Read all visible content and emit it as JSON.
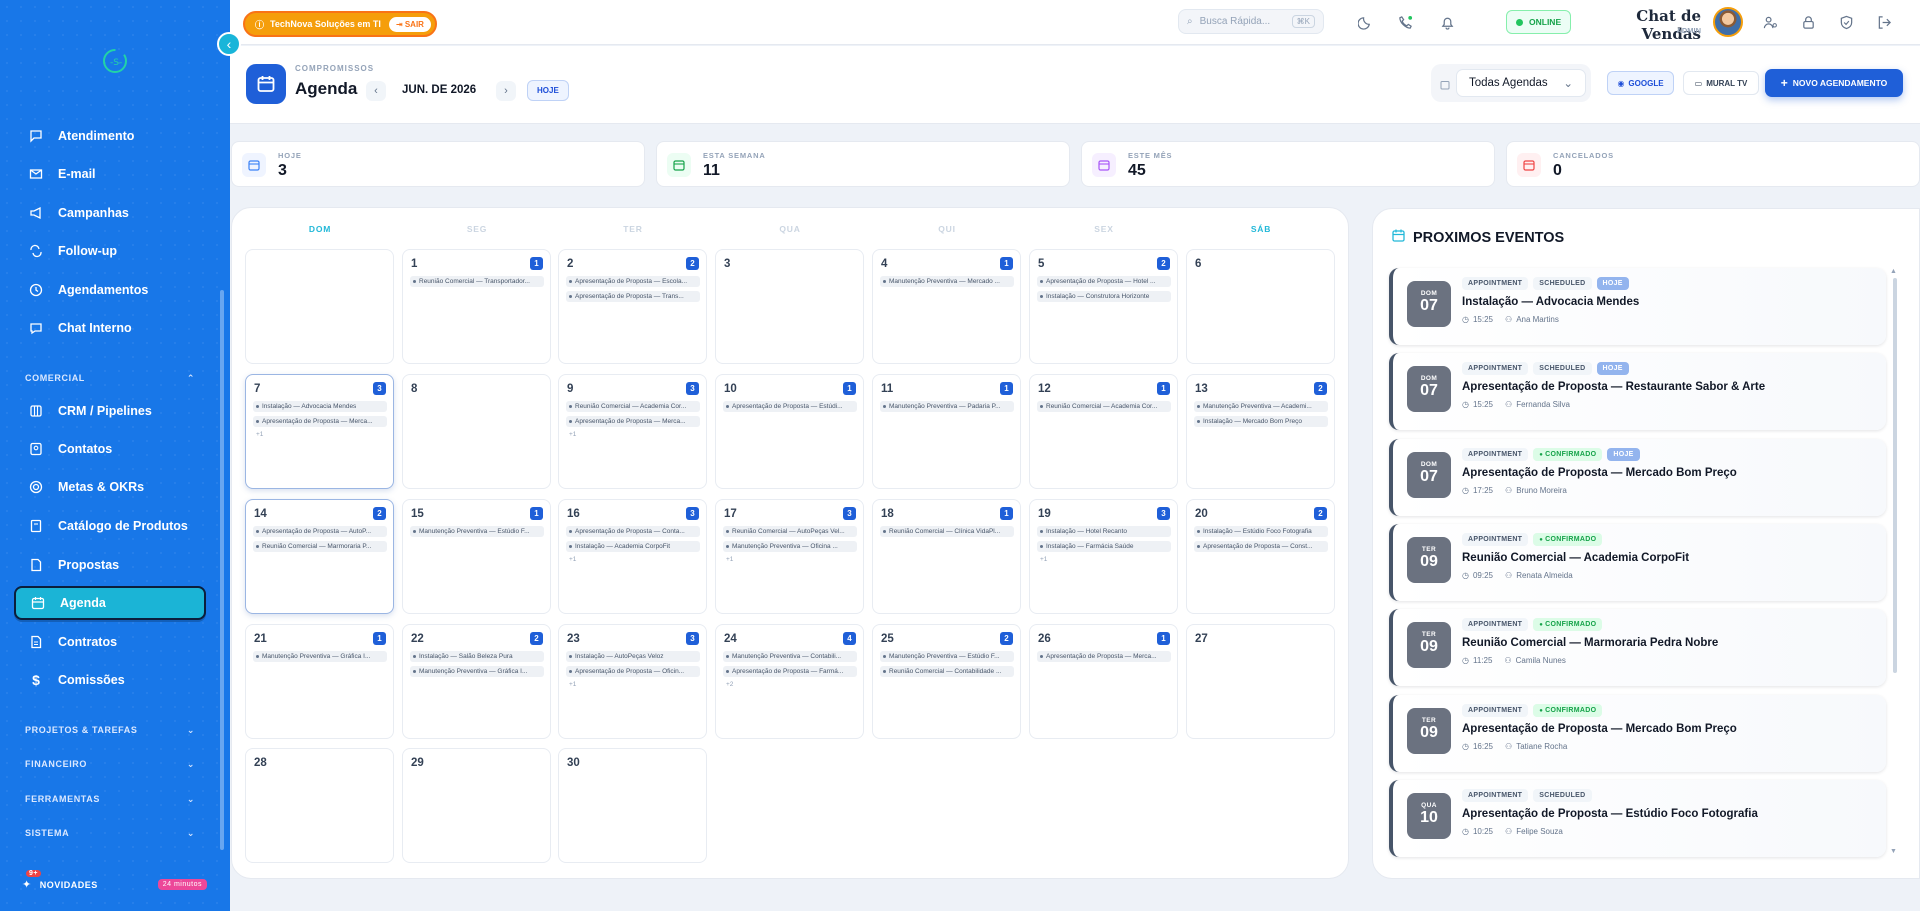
{
  "sidebar": {
    "items": [
      {
        "label": "Atendimento",
        "icon": "message-square-icon"
      },
      {
        "label": "E-mail",
        "icon": "mail-icon"
      },
      {
        "label": "Campanhas",
        "icon": "megaphone-icon"
      },
      {
        "label": "Follow-up",
        "icon": "repeat-icon"
      },
      {
        "label": "Agendamentos",
        "icon": "clock-icon"
      },
      {
        "label": "Chat Interno",
        "icon": "chat-icon"
      },
      {
        "label": "CRM / Pipelines",
        "icon": "columns-icon"
      },
      {
        "label": "Contatos",
        "icon": "contact-card-icon"
      },
      {
        "label": "Metas & OKRs",
        "icon": "target-icon"
      },
      {
        "label": "Catálogo de Produtos",
        "icon": "book-icon"
      },
      {
        "label": "Propostas",
        "icon": "document-icon"
      },
      {
        "label": "Agenda",
        "icon": "calendar-icon",
        "active": true
      },
      {
        "label": "Contratos",
        "icon": "file-icon"
      },
      {
        "label": "Comissões",
        "icon": "dollar-icon"
      }
    ],
    "sections": {
      "comercial": "COMERCIAL",
      "projetos": "PROJETOS & TAREFAS",
      "financeiro": "FINANCEIRO",
      "ferramentas": "FERRAMENTAS",
      "sistema": "SISTEMA"
    },
    "news": {
      "label": "NOVIDADES",
      "badge": "9+",
      "time": "24 minutos"
    }
  },
  "topbar": {
    "company": "TechNova Soluções em TI",
    "logout": "SAIR",
    "search_placeholder": "Busca Rápida...",
    "search_shortcut": "⌘K",
    "status": "ONLINE",
    "user_name": "Chat de Vendas",
    "user_role": "ADMIN"
  },
  "header": {
    "subtitle": "COMPROMISSOS",
    "title": "Agenda",
    "month": "JUN. DE 2026",
    "today_button": "HOJE",
    "agendas_select": "Todas Agendas",
    "google_button": "GOOGLE",
    "mural_button": "MURAL TV",
    "new_button": "NOVO AGENDAMENTO"
  },
  "stats": [
    {
      "label": "HOJE",
      "value": "3",
      "color": "#3b82f6"
    },
    {
      "label": "ESTA SEMANA",
      "value": "11",
      "color": "#16a34a"
    },
    {
      "label": "ESTE MÊS",
      "value": "45",
      "color": "#a855f7"
    },
    {
      "label": "CANCELADOS",
      "value": "0",
      "color": "#ef4444"
    }
  ],
  "calendar": {
    "weekdays": [
      "DOM",
      "SEG",
      "TER",
      "QUA",
      "QUI",
      "SEX",
      "SÁB"
    ],
    "days": [
      {
        "n": "1",
        "count": "1",
        "events": [
          "Reunião Comercial — Transportador..."
        ]
      },
      {
        "n": "2",
        "count": "2",
        "events": [
          "Apresentação de Proposta — Escola...",
          "Apresentação de Proposta — Trans..."
        ]
      },
      {
        "n": "3",
        "count": "",
        "events": []
      },
      {
        "n": "4",
        "count": "1",
        "events": [
          "Manutenção Preventiva — Mercado ..."
        ]
      },
      {
        "n": "5",
        "count": "2",
        "events": [
          "Apresentação de Proposta — Hotel ...",
          "Instalação — Construtora Horizonte"
        ]
      },
      {
        "n": "6",
        "count": "",
        "events": []
      },
      {
        "n": "7",
        "count": "3",
        "events": [
          "Instalação — Advocacia Mendes",
          "Apresentação de Proposta — Merca..."
        ],
        "more": "+1",
        "today": true
      },
      {
        "n": "8",
        "count": "",
        "events": []
      },
      {
        "n": "9",
        "count": "3",
        "events": [
          "Reunião Comercial — Academia Cor...",
          "Apresentação de Proposta — Merca..."
        ],
        "more": "+1"
      },
      {
        "n": "10",
        "count": "1",
        "events": [
          "Apresentação de Proposta — Estúdi..."
        ]
      },
      {
        "n": "11",
        "count": "1",
        "events": [
          "Manutenção Preventiva — Padaria P..."
        ]
      },
      {
        "n": "12",
        "count": "1",
        "events": [
          "Reunião Comercial — Academia Cor..."
        ]
      },
      {
        "n": "13",
        "count": "2",
        "events": [
          "Manutenção Preventiva — Academi...",
          "Instalação — Mercado Bom Preço"
        ]
      },
      {
        "n": "14",
        "count": "2",
        "events": [
          "Apresentação de Proposta — AutoP...",
          "Reunião Comercial — Marmoraria P..."
        ],
        "today": true
      },
      {
        "n": "15",
        "count": "1",
        "events": [
          "Manutenção Preventiva — Estúdio F..."
        ]
      },
      {
        "n": "16",
        "count": "3",
        "events": [
          "Apresentação de Proposta — Conta...",
          "Instalação — Academia CorpoFit"
        ],
        "more": "+1"
      },
      {
        "n": "17",
        "count": "3",
        "events": [
          "Reunião Comercial — AutoPeças Vel...",
          "Manutenção Preventiva — Oficina ..."
        ],
        "more": "+1"
      },
      {
        "n": "18",
        "count": "1",
        "events": [
          "Reunião Comercial — Clínica VidaPl..."
        ]
      },
      {
        "n": "19",
        "count": "3",
        "events": [
          "Instalação — Hotel Recanto",
          "Instalação — Farmácia Saúde"
        ],
        "more": "+1"
      },
      {
        "n": "20",
        "count": "2",
        "events": [
          "Instalação — Estúdio Foco Fotografia",
          "Apresentação de Proposta — Const..."
        ]
      },
      {
        "n": "21",
        "count": "1",
        "events": [
          "Manutenção Preventiva — Gráfica I..."
        ]
      },
      {
        "n": "22",
        "count": "2",
        "events": [
          "Instalação — Salão Beleza Pura",
          "Manutenção Preventiva — Gráfica I..."
        ]
      },
      {
        "n": "23",
        "count": "3",
        "events": [
          "Instalação — AutoPeças Veloz",
          "Apresentação de Proposta — Oficin..."
        ],
        "more": "+1"
      },
      {
        "n": "24",
        "count": "4",
        "events": [
          "Manutenção Preventiva — Contabili...",
          "Apresentação de Proposta — Farmá..."
        ],
        "more": "+2"
      },
      {
        "n": "25",
        "count": "2",
        "events": [
          "Manutenção Preventiva — Estúdio F...",
          "Reunião Comercial — Contabilidade ..."
        ]
      },
      {
        "n": "26",
        "count": "1",
        "events": [
          "Apresentação de Proposta — Merca..."
        ]
      },
      {
        "n": "27",
        "count": "",
        "events": []
      },
      {
        "n": "28",
        "count": "",
        "events": []
      },
      {
        "n": "29",
        "count": "",
        "events": []
      },
      {
        "n": "30",
        "count": "",
        "events": []
      }
    ]
  },
  "upcoming": {
    "title": "PROXIMOS EVENTOS",
    "events": [
      {
        "dow": "DOM",
        "day": "07",
        "type": "APPOINTMENT",
        "status": "SCHEDULED",
        "status_kind": "gray",
        "hoje": "HOJE",
        "title": "Instalação — Advocacia Mendes",
        "time": "15:25",
        "person": "Ana Martins"
      },
      {
        "dow": "DOM",
        "day": "07",
        "type": "APPOINTMENT",
        "status": "SCHEDULED",
        "status_kind": "gray",
        "hoje": "HOJE",
        "title": "Apresentação de Proposta — Restaurante Sabor & Arte",
        "time": "15:25",
        "person": "Fernanda Silva"
      },
      {
        "dow": "DOM",
        "day": "07",
        "type": "APPOINTMENT",
        "status": "CONFIRMADO",
        "status_kind": "conf",
        "hoje": "HOJE",
        "title": "Apresentação de Proposta — Mercado Bom Preço",
        "time": "17:25",
        "person": "Bruno Moreira"
      },
      {
        "dow": "TER",
        "day": "09",
        "type": "APPOINTMENT",
        "status": "CONFIRMADO",
        "status_kind": "conf",
        "hoje": "",
        "title": "Reunião Comercial — Academia CorpoFit",
        "time": "09:25",
        "person": "Renata Almeida"
      },
      {
        "dow": "TER",
        "day": "09",
        "type": "APPOINTMENT",
        "status": "CONFIRMADO",
        "status_kind": "conf",
        "hoje": "",
        "title": "Reunião Comercial — Marmoraria Pedra Nobre",
        "time": "11:25",
        "person": "Camila Nunes"
      },
      {
        "dow": "TER",
        "day": "09",
        "type": "APPOINTMENT",
        "status": "CONFIRMADO",
        "status_kind": "conf",
        "hoje": "",
        "title": "Apresentação de Proposta — Mercado Bom Preço",
        "time": "16:25",
        "person": "Tatiane Rocha"
      },
      {
        "dow": "QUA",
        "day": "10",
        "type": "APPOINTMENT",
        "status": "SCHEDULED",
        "status_kind": "gray",
        "hoje": "",
        "title": "Apresentação de Proposta — Estúdio Foco Fotografia",
        "time": "10:25",
        "person": "Felipe Souza"
      }
    ]
  }
}
